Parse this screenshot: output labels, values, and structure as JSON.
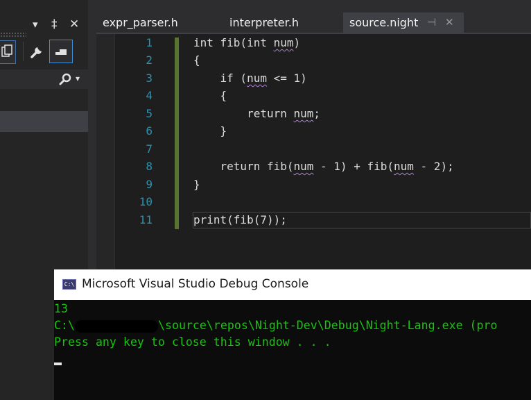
{
  "tool_panel": {
    "pin_glyph": "‡",
    "close_glyph": "✕",
    "dropdown_glyph": "▾",
    "search_glyph": "⌕"
  },
  "tabs": [
    {
      "label": "expr_parser.h",
      "active": false
    },
    {
      "label": "interpreter.h",
      "active": false
    },
    {
      "label": "source.night",
      "active": true
    }
  ],
  "tab_icons": {
    "pin": "⊣",
    "close": "✕"
  },
  "editor": {
    "line_numbers": [
      "1",
      "2",
      "3",
      "4",
      "5",
      "6",
      "7",
      "8",
      "9",
      "10",
      "11"
    ],
    "current_line": 11
  },
  "console": {
    "title": "Microsoft Visual Studio Debug Console",
    "icon_text": "C:\\",
    "output_1": "13",
    "output_2_prefix": "C:\\",
    "output_2_suffix": "\\source\\repos\\Night-Dev\\Debug\\Night-Lang.exe (pro",
    "output_3": "Press any key to close this window . . ."
  },
  "colors": {
    "editor_bg": "#1e1e1e",
    "line_number": "#2b91af",
    "change_bar": "#577430",
    "console_text": "#16c60c",
    "squiggle": "#b180d7"
  }
}
